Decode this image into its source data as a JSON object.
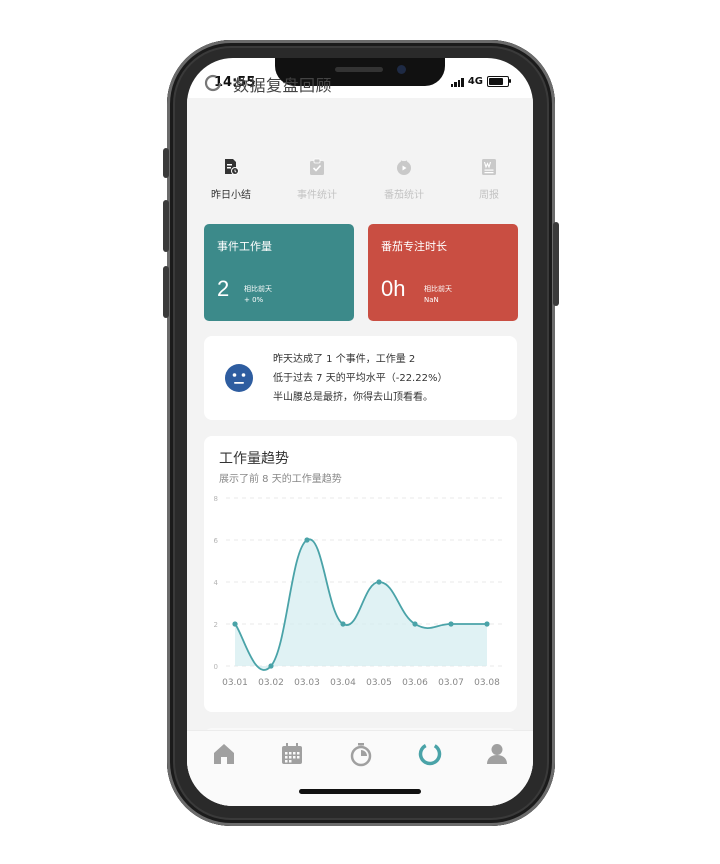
{
  "status": {
    "time": "14:55",
    "network": "4G"
  },
  "header": {
    "title": "数据复盘回顾",
    "icon": "ring-icon"
  },
  "tabs": [
    {
      "label": "昨日小结",
      "icon": "daily-summary-icon",
      "active": true
    },
    {
      "label": "事件统计",
      "icon": "task-check-icon",
      "active": false
    },
    {
      "label": "番茄统计",
      "icon": "tomato-timer-icon",
      "active": false
    },
    {
      "label": "周报",
      "icon": "weekly-report-icon",
      "active": false
    }
  ],
  "cards": {
    "workload": {
      "title": "事件工作量",
      "value": "2",
      "compare_label": "相比前天",
      "compare_value": "+ 0%",
      "color": "#3c8a8a"
    },
    "focus": {
      "title": "番茄专注时长",
      "value": "0h",
      "compare_label": "相比前天",
      "compare_value": "NaN",
      "color": "#c94e42"
    }
  },
  "summary": {
    "icon": "neutral-face-icon",
    "lines": [
      "昨天达成了 1 个事件，工作量 2",
      "低于过去 7 天的平均水平（-22.22%）",
      "半山腰总是最挤，你得去山顶看看。"
    ]
  },
  "trend": {
    "title": "工作量趋势",
    "subtitle": "展示了前 8 天的工作量趋势"
  },
  "chart_data": {
    "type": "area",
    "categories": [
      "03.01",
      "03.02",
      "03.03",
      "03.04",
      "03.05",
      "03.06",
      "03.07",
      "03.08"
    ],
    "values": [
      2,
      0,
      6,
      2,
      4,
      2,
      2,
      2
    ],
    "yticks": [
      0,
      2,
      4,
      6,
      8
    ],
    "ylim": [
      0,
      8
    ],
    "grid": true,
    "line_color": "#4aa3a8",
    "fill_color": "#d6eef0"
  },
  "navbar": [
    {
      "name": "home",
      "icon": "home-icon",
      "active": false
    },
    {
      "name": "calendar",
      "icon": "calendar-icon",
      "active": false
    },
    {
      "name": "timer",
      "icon": "stopwatch-icon",
      "active": false
    },
    {
      "name": "review",
      "icon": "ring-chart-icon",
      "active": true
    },
    {
      "name": "profile",
      "icon": "user-icon",
      "active": false
    }
  ],
  "colors": {
    "accent": "#4aa3a8",
    "icon_gray": "#9a9a9a",
    "active_nav": "#4aa3a8"
  }
}
